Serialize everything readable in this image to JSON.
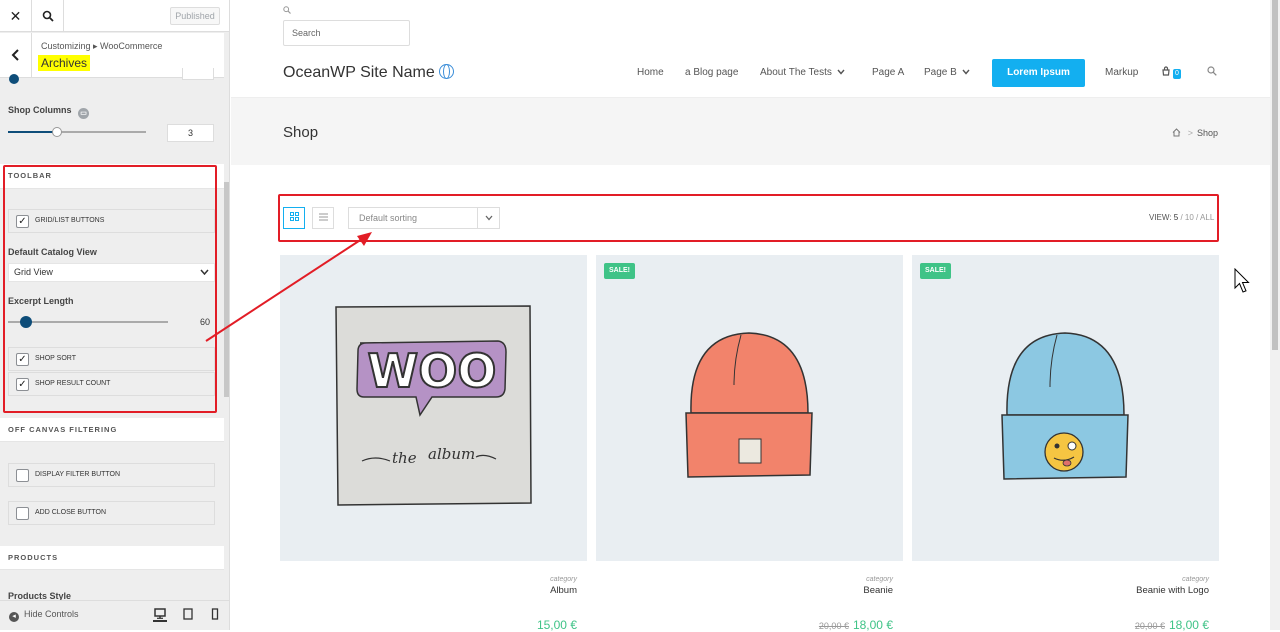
{
  "customizer": {
    "published_label": "Published",
    "breadcrumb": "Customizing ▸ WooCommerce",
    "section_title": "Archives",
    "shop_columns_label": "Shop Columns",
    "shop_columns_value": "3",
    "toolbar_heading": "TOOLBAR",
    "grid_list_buttons_label": "GRID/LIST BUTTONS",
    "default_catalog_view_label": "Default Catalog View",
    "default_catalog_view_value": "Grid View",
    "excerpt_length_label": "Excerpt Length",
    "excerpt_length_value": "60",
    "shop_sort_label": "SHOP SORT",
    "shop_result_count_label": "SHOP RESULT COUNT",
    "off_canvas_heading": "OFF CANVAS FILTERING",
    "display_filter_button_label": "DISPLAY FILTER BUTTON",
    "add_close_button_label": "ADD CLOSE BUTTON",
    "products_heading": "PRODUCTS",
    "products_style_label": "Products Style",
    "hide_controls_label": "Hide Controls",
    "grid_list_checked": true,
    "shop_sort_checked": true,
    "shop_result_count_checked": true,
    "display_filter_checked": false,
    "add_close_checked": false
  },
  "site": {
    "search_placeholder": "Search",
    "site_name": "OceanWP Site Name",
    "nav": {
      "home": "Home",
      "blog": "a Blog page",
      "about": "About The Tests",
      "page_a": "Page A",
      "page_b": "Page B",
      "cta": "Lorem Ipsum",
      "markup": "Markup",
      "cart_count": "0"
    },
    "page_title": "Shop",
    "breadcrumb_current": "Shop",
    "breadcrumb_sep": ">",
    "sort_value": "Default sorting",
    "view_label": "VIEW:",
    "view_options": [
      "5",
      "10",
      "ALL"
    ],
    "sale_label": "SALE!",
    "products": [
      {
        "category": "category",
        "name": "Album",
        "price": "15,00 €",
        "old_price": ""
      },
      {
        "category": "category",
        "name": "Beanie",
        "price": "18,00 €",
        "old_price": "20,00 €"
      },
      {
        "category": "category",
        "name": "Beanie with Logo",
        "price": "18,00 €",
        "old_price": "20,00 €"
      }
    ],
    "album_word": "WOO",
    "album_sub1": "the",
    "album_sub2": "album"
  },
  "colors": {
    "accent": "#13aff0",
    "sale": "#3fc387",
    "highlight_box": "#e21d26",
    "slider": "#0e4d79"
  }
}
